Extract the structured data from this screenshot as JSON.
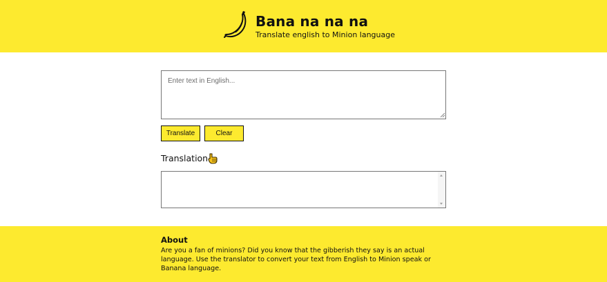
{
  "header": {
    "logo_icon": "banana-icon",
    "title": "Bana na na na",
    "subtitle": "Translate english to Minion language"
  },
  "input": {
    "placeholder": "Enter text in English...",
    "value": ""
  },
  "buttons": {
    "translate_label": "Translate",
    "clear_label": "Clear"
  },
  "translation": {
    "heading": "Translation",
    "heading_icon": "pointing-down-hand-icon",
    "output": ""
  },
  "about": {
    "heading": "About",
    "text": "Are you a fan of minions? Did you know that the gibberish they say is an actual language. Use the translator to convert your text from English to Minion speak or Banana language."
  },
  "colors": {
    "brand_yellow": "#fdea2f",
    "text": "#111111",
    "border": "#767676"
  }
}
